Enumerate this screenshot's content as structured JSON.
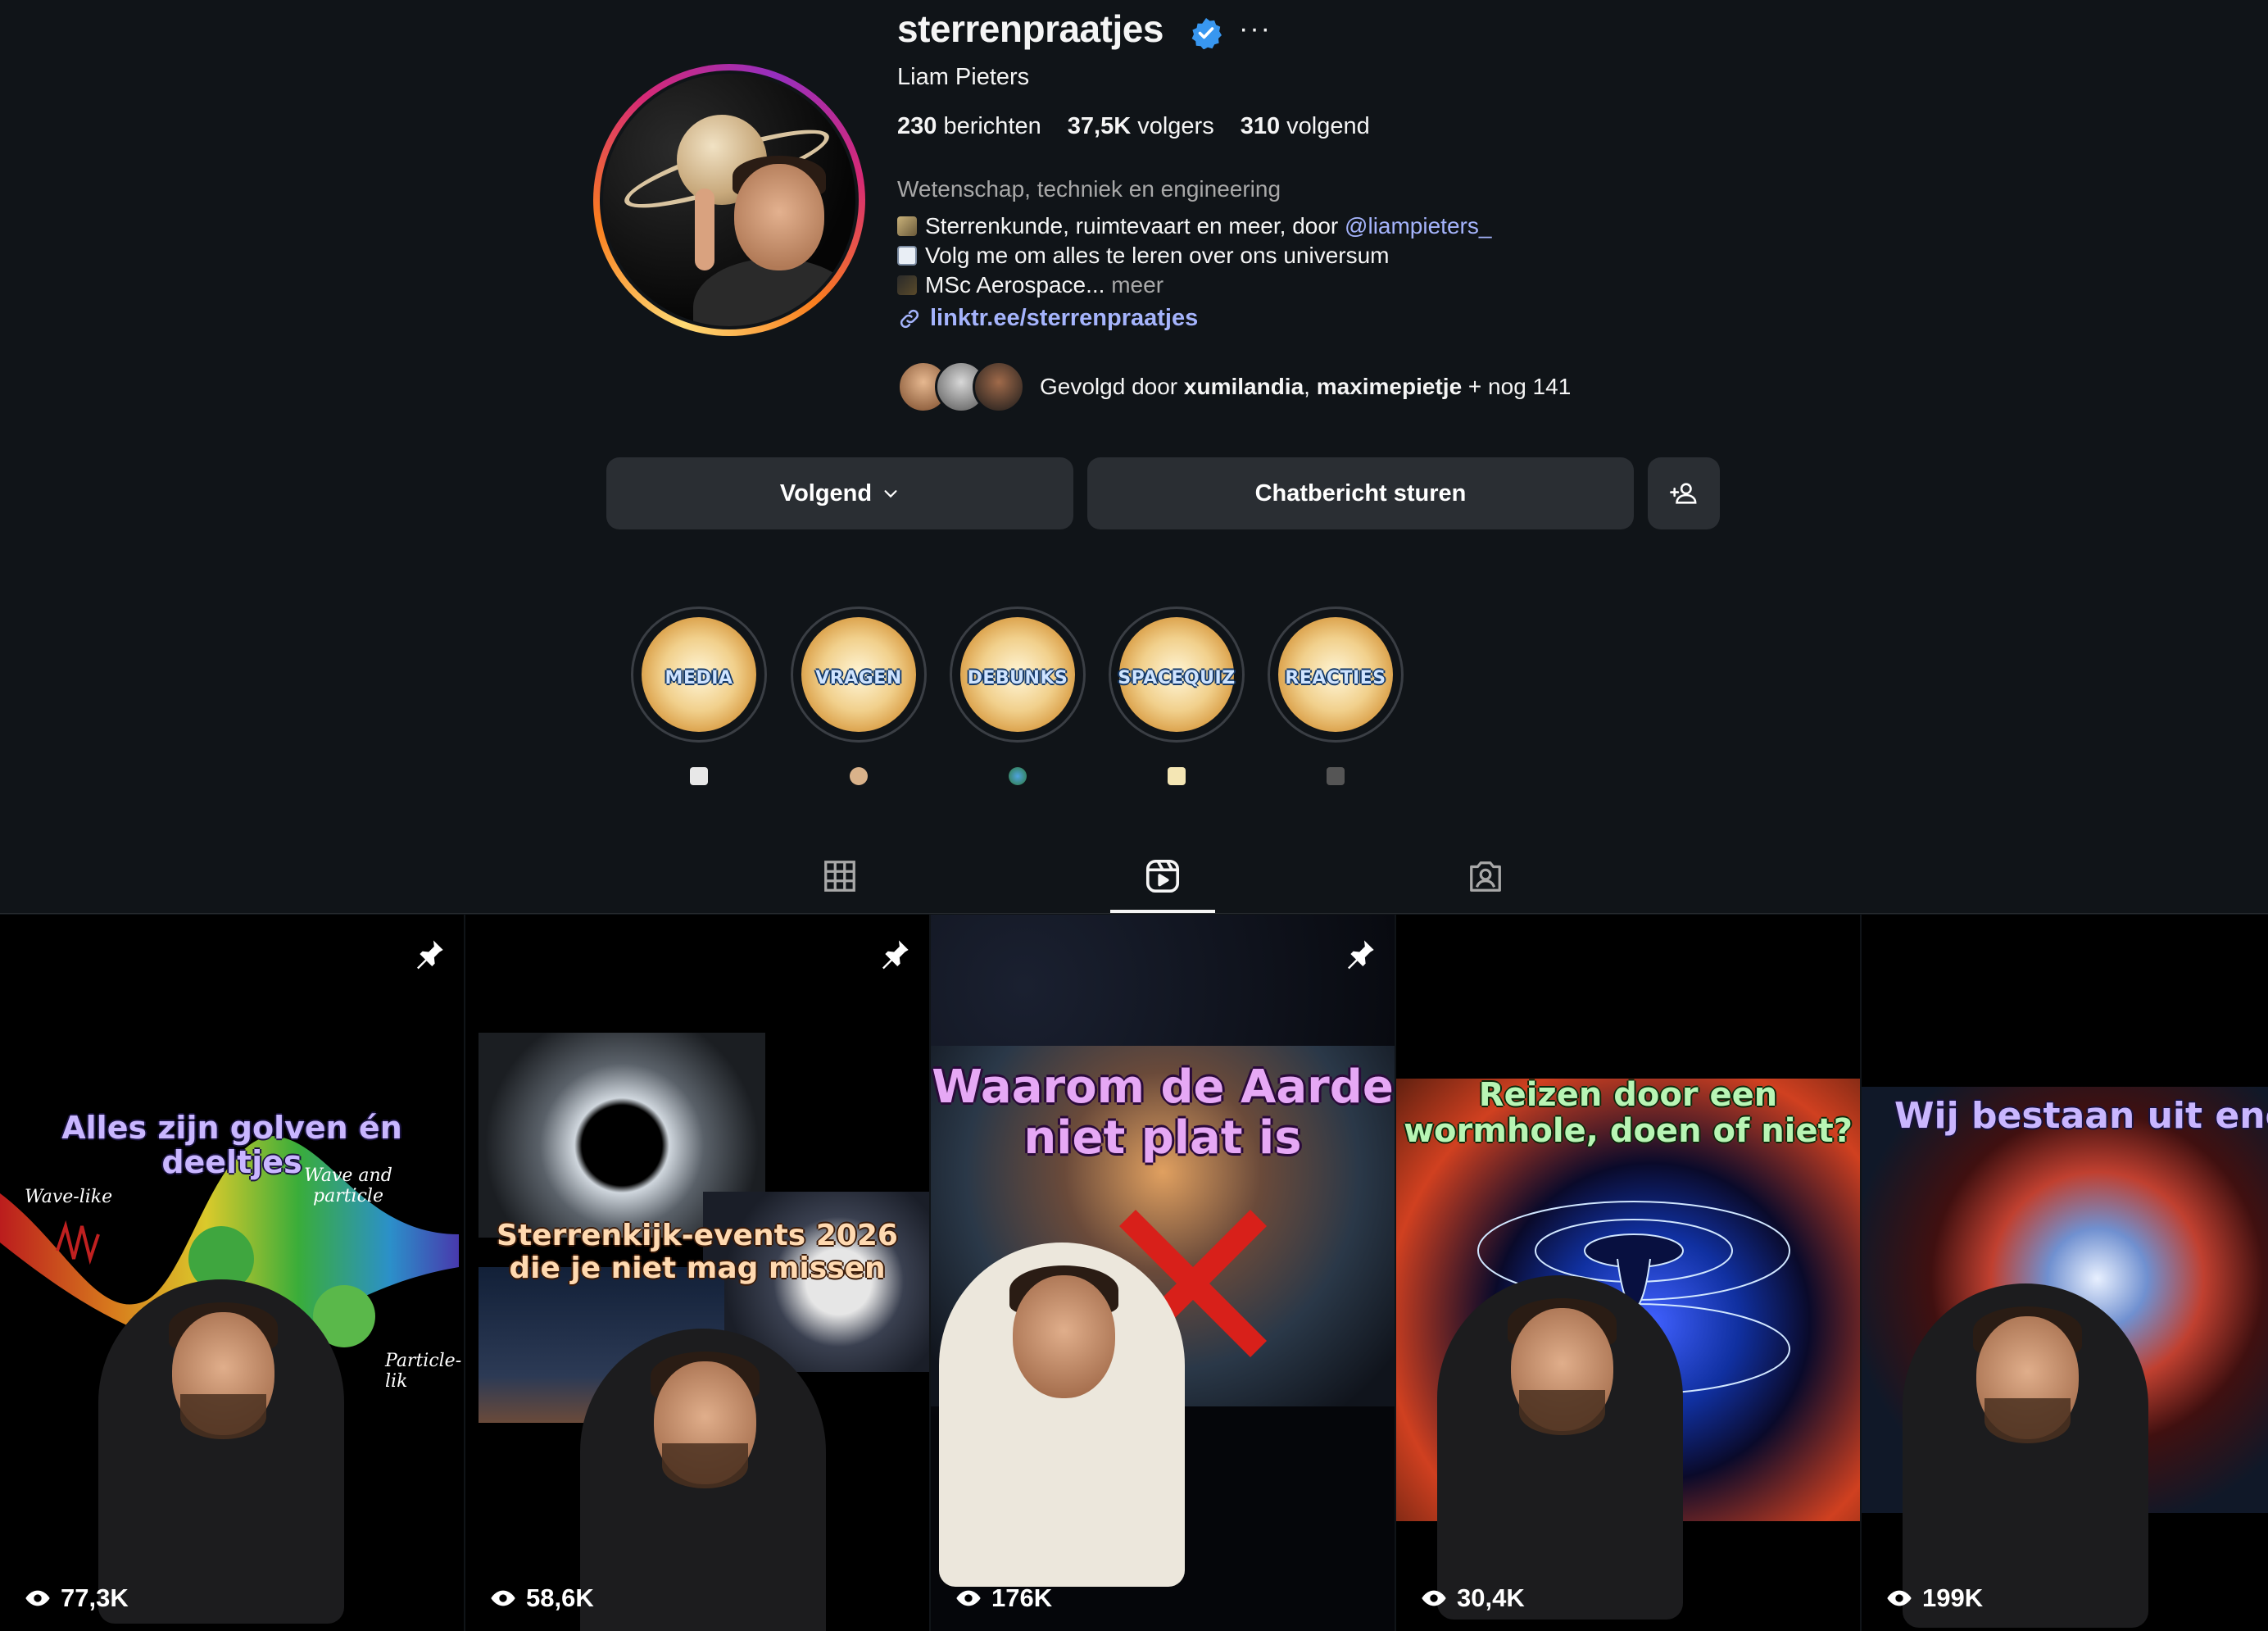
{
  "profile": {
    "username": "sterrenpraatjes",
    "full_name": "Liam Pieters",
    "stats": {
      "posts": "230",
      "posts_label": "berichten",
      "followers": "37,5K",
      "followers_label": "volgers",
      "following": "310",
      "following_label": "volgend"
    },
    "category": "Wetenschap, techniek en engineering",
    "bio": {
      "line1": "Sterrenkunde, ruimtevaart en meer, door ",
      "line1_mention": "@liampieters_",
      "line2": "Volg me om alles te leren over ons universum",
      "line3": "MSc Aerospace...",
      "line3_more": "meer"
    },
    "link": "linktr.ee/sterrenpraatjes",
    "followed_by": {
      "prefix": "Gevolgd door ",
      "user1": "xumilandia",
      "sep": ", ",
      "user2": "maximepietje",
      "suffix": " + nog 141"
    }
  },
  "buttons": {
    "following": "Volgend",
    "message": "Chatbericht sturen"
  },
  "highlights": [
    {
      "label": "MEDIA"
    },
    {
      "label": "VRAGEN"
    },
    {
      "label": "DEBUNKS"
    },
    {
      "label": "SPACEQUIZ"
    },
    {
      "label": "REACTIES"
    }
  ],
  "reels": [
    {
      "title": "Alles zijn golven én deeltjes",
      "views": "77,3K",
      "pinned": true,
      "title_color": "#c9b6ff",
      "extra1": "Wave-like",
      "extra2": "Wave and particle",
      "extra3": "Particle-lik"
    },
    {
      "title": "Sterrenkijk-events 2026 die je niet mag missen",
      "views": "58,6K",
      "pinned": true,
      "title_color": "#ffd9b0"
    },
    {
      "title": "Waarom de Aarde niet plat is",
      "views": "176K",
      "pinned": true,
      "title_color": "#e6a8f5"
    },
    {
      "title": "Reizen door een wormhole, doen of niet?",
      "views": "30,4K",
      "pinned": false,
      "title_color": "#b8f5b4"
    },
    {
      "title": "Wij bestaan uit energie en leegte",
      "views": "199K",
      "pinned": false,
      "title_color": "#c9b6ff"
    }
  ],
  "colors": {
    "background": "#101418",
    "button": "#2a2e33",
    "link": "#a5b4fc",
    "verified": "#3897f0"
  }
}
